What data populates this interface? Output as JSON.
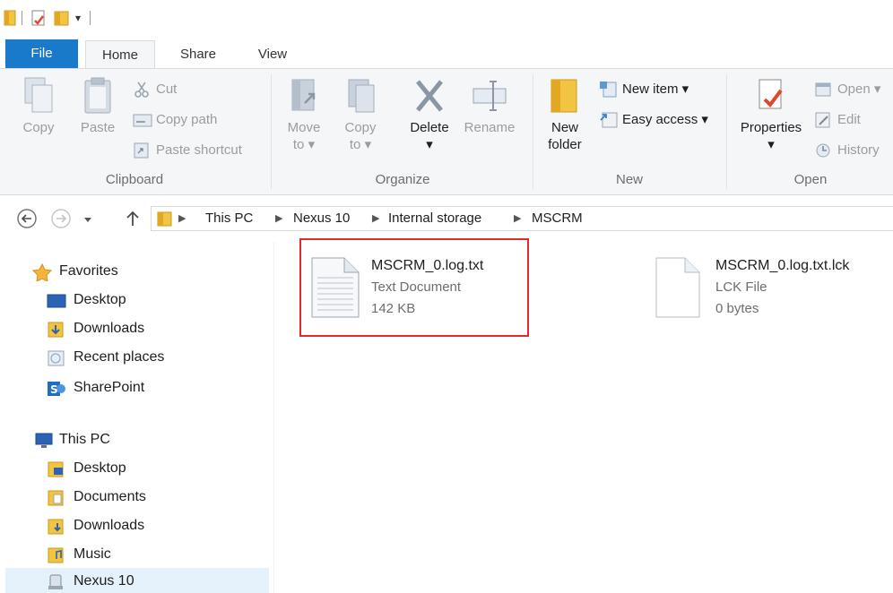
{
  "window": {
    "qat_dropdown_glyph": "▾"
  },
  "ribbon_tabs": [
    "File",
    "Home",
    "Share",
    "View"
  ],
  "ribbon": {
    "clipboard": {
      "label": "Clipboard",
      "copy": "Copy",
      "paste": "Paste",
      "cut": "Cut",
      "copy_path": "Copy path",
      "paste_shortcut": "Paste shortcut"
    },
    "organize": {
      "label": "Organize",
      "move_to": [
        "Move",
        "to"
      ],
      "copy_to": [
        "Copy",
        "to"
      ],
      "delete": "Delete",
      "rename": "Rename"
    },
    "new": {
      "label": "New",
      "new_folder": [
        "New",
        "folder"
      ],
      "new_item": "New item",
      "easy_access": "Easy access"
    },
    "open": {
      "label": "Open",
      "properties": "Properties",
      "open": "Open",
      "edit": "Edit",
      "history": "History"
    }
  },
  "address": {
    "breadcrumbs": [
      "This PC",
      "Nexus 10",
      "Internal storage",
      "MSCRM"
    ]
  },
  "nav": {
    "favorites": {
      "label": "Favorites",
      "items": [
        "Desktop",
        "Downloads",
        "Recent places",
        "SharePoint"
      ]
    },
    "this_pc": {
      "label": "This PC",
      "items": [
        "Desktop",
        "Documents",
        "Downloads",
        "Music",
        "Nexus 10"
      ]
    }
  },
  "files": [
    {
      "name": "MSCRM_0.log.txt",
      "type": "Text Document",
      "size": "142 KB",
      "highlighted": true
    },
    {
      "name": "MSCRM_0.log.txt.lck",
      "type": "LCK File",
      "size": "0 bytes",
      "highlighted": false
    }
  ],
  "colors": {
    "file_tab": "#1979ca",
    "highlight": "#e12b2b",
    "selection": "#e5f1fb",
    "folder": "#f2c443"
  }
}
